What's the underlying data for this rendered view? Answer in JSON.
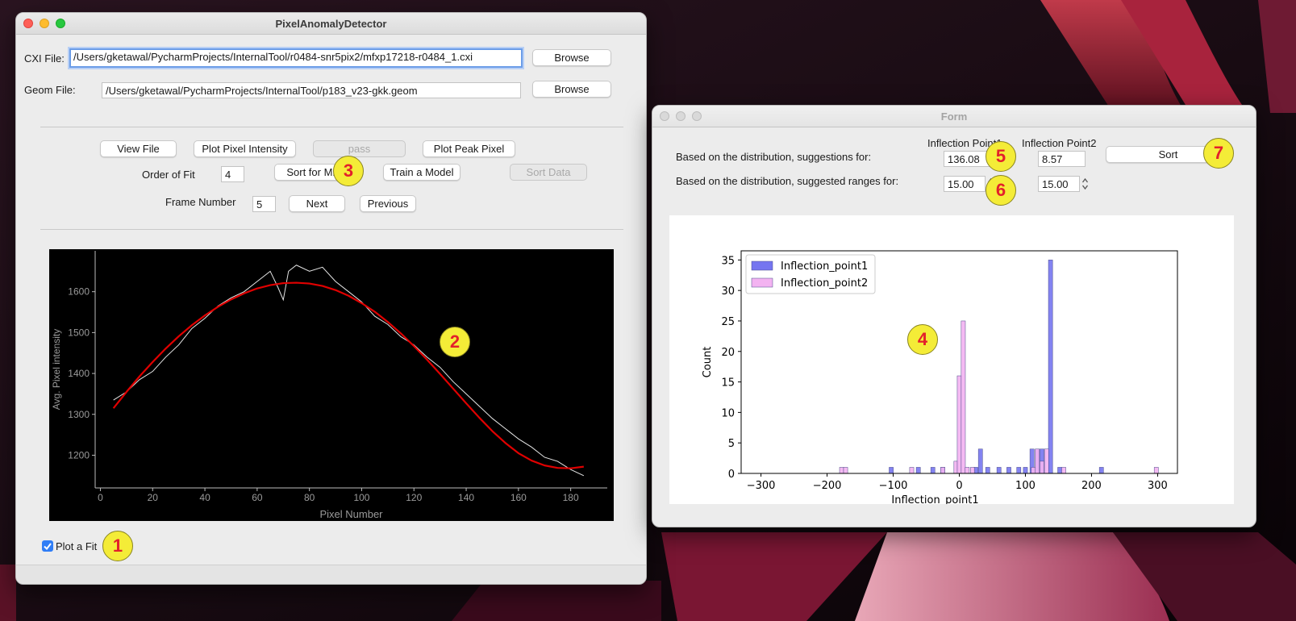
{
  "main_window": {
    "title": "PixelAnomalyDetector",
    "cxi_label": "CXI File:",
    "cxi_value": "/Users/gketawal/PycharmProjects/InternalTool/r0484-snr5pix2/mfxp17218-r0484_1.cxi",
    "geom_label": "Geom File:",
    "geom_value": "/Users/gketawal/PycharmProjects/InternalTool/p183_v23-gkk.geom",
    "browse_label": "Browse",
    "view_file": "View File",
    "plot_pixel_intensity": "Plot Pixel Intensity",
    "pass": "pass",
    "plot_peak_pixel": "Plot Peak Pixel",
    "order_of_fit_label": "Order of Fit",
    "order_of_fit_value": "4",
    "sort_for_ml": "Sort for ML",
    "train_model": "Train a Model",
    "sort_data": "Sort Data",
    "frame_number_label": "Frame Number",
    "frame_number_value": "5",
    "next": "Next",
    "previous": "Previous",
    "plot_fit_label": "Plot a Fit",
    "plot_fit_checked": true
  },
  "form_window": {
    "title": "Form",
    "col1_header": "Inflection Point1",
    "col2_header": "Inflection Point2",
    "suggestions_label": "Based on the distribution, suggestions for:",
    "ranges_label": "Based on the distribution, suggested ranges for:",
    "ip1_value": "136.08",
    "ip2_value": "8.57",
    "range1_value": "15.00",
    "range2_value": "15.00",
    "sort": "Sort"
  },
  "markers": [
    "1",
    "2",
    "3",
    "4",
    "5",
    "6",
    "7"
  ],
  "colors": {
    "plot_bg": "#000000",
    "fit_line": "#e00000",
    "series1": "#7575f0",
    "series2": "#f3b3f1",
    "marker_fill": "#f4ec37",
    "marker_text": "#e3202b"
  },
  "chart_data": [
    {
      "type": "line",
      "xlabel": "Pixel Number",
      "ylabel": "Avg. Pixel intensity",
      "xlim": [
        -2,
        194
      ],
      "ylim": [
        1120,
        1700
      ],
      "xticks": [
        0,
        20,
        40,
        60,
        80,
        100,
        120,
        140,
        160,
        180
      ],
      "yticks": [
        1200,
        1300,
        1400,
        1500,
        1600
      ],
      "grid": false,
      "series": [
        {
          "x": [
            5,
            10,
            15,
            20,
            25,
            30,
            35,
            40,
            45,
            50,
            55,
            60,
            65,
            68,
            70,
            72,
            75,
            80,
            85,
            90,
            95,
            100,
            105,
            110,
            115,
            120,
            125,
            130,
            135,
            140,
            145,
            150,
            155,
            160,
            165,
            170,
            175,
            180,
            185
          ],
          "y": [
            1335,
            1355,
            1385,
            1405,
            1440,
            1470,
            1510,
            1535,
            1565,
            1585,
            1600,
            1625,
            1650,
            1610,
            1580,
            1650,
            1665,
            1650,
            1660,
            1625,
            1600,
            1575,
            1540,
            1520,
            1490,
            1470,
            1440,
            1415,
            1380,
            1350,
            1320,
            1290,
            1265,
            1240,
            1220,
            1195,
            1185,
            1165,
            1150
          ]
        },
        {
          "x": [
            5,
            10,
            15,
            20,
            25,
            30,
            35,
            40,
            45,
            50,
            55,
            60,
            65,
            70,
            75,
            80,
            85,
            90,
            95,
            100,
            105,
            110,
            115,
            120,
            125,
            130,
            135,
            140,
            145,
            150,
            155,
            160,
            165,
            170,
            175,
            180,
            185
          ],
          "y": [
            1315,
            1355,
            1393,
            1428,
            1461,
            1491,
            1518,
            1542,
            1563,
            1581,
            1596,
            1608,
            1616,
            1621,
            1622,
            1620,
            1614,
            1604,
            1590,
            1572,
            1551,
            1526,
            1498,
            1467,
            1434,
            1399,
            1363,
            1327,
            1292,
            1259,
            1230,
            1205,
            1187,
            1175,
            1169,
            1168,
            1172
          ]
        }
      ]
    },
    {
      "type": "bar",
      "xlabel": "Inflection_point1",
      "ylabel": "Count",
      "xlim": [
        -330,
        330
      ],
      "ylim": [
        0,
        36.5
      ],
      "xticks": [
        -300,
        -200,
        -100,
        0,
        100,
        200,
        300
      ],
      "yticks": [
        0,
        5,
        10,
        15,
        20,
        25,
        30,
        35
      ],
      "legend": "top-left",
      "bin_width": 6.3,
      "series": [
        {
          "name": "Inflection_point1",
          "x": [
            -103,
            -62,
            -40,
            -25,
            25,
            32,
            43,
            60,
            75,
            90,
            100,
            110,
            118,
            125,
            138,
            152,
            215
          ],
          "values": [
            1,
            1,
            1,
            1,
            1,
            4,
            1,
            1,
            1,
            1,
            1,
            4,
            4,
            4,
            35,
            1,
            1
          ]
        },
        {
          "name": "Inflection_point2",
          "x": [
            -178,
            -172,
            -72,
            -25,
            -5,
            0,
            6,
            12,
            20,
            112,
            118,
            125,
            132,
            158,
            298
          ],
          "values": [
            1,
            1,
            1,
            1,
            2,
            16,
            25,
            1,
            1,
            1,
            4,
            2,
            4,
            1,
            1
          ]
        }
      ]
    }
  ]
}
